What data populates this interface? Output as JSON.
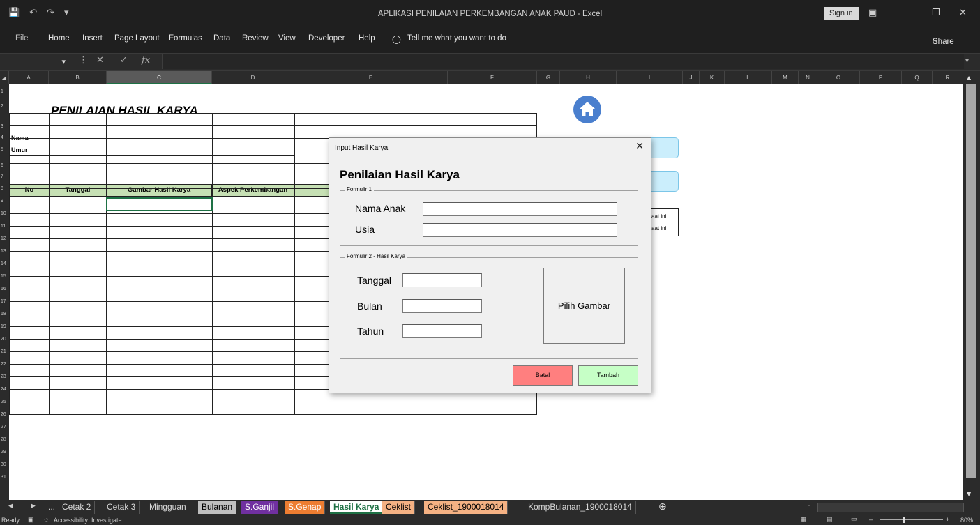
{
  "window": {
    "title": "APLIKASI PENILAIAN PERKEMBANGAN ANAK PAUD  -  Excel",
    "sign_in": "Sign in"
  },
  "ribbon": {
    "tabs": [
      "File",
      "Home",
      "Insert",
      "Page Layout",
      "Formulas",
      "Data",
      "Review",
      "View",
      "Developer",
      "Help"
    ],
    "tell_me": "Tell me what you want to do",
    "share": "Share"
  },
  "formula_bar": {
    "fx": "fx"
  },
  "columns": [
    "A",
    "B",
    "C",
    "D",
    "E",
    "F",
    "G",
    "H",
    "I",
    "J",
    "K",
    "L",
    "M",
    "N",
    "O",
    "P",
    "Q",
    "R"
  ],
  "sheet": {
    "title": "PENILAIAN HASIL KARYA",
    "nama_label": "Nama",
    "umur_label": "Umur",
    "headers": {
      "no": "No",
      "tanggal": "Tanggal",
      "gambar": "Gambar Hasil Karya",
      "aspek": "Aspek Perkembangan"
    },
    "note_line1": "aat ini",
    "note_line2": "aat ini"
  },
  "dialog": {
    "title": "Input Hasil Karya",
    "heading": "Penilaian Hasil Karya",
    "frame1_caption": "Formulir 1",
    "nama_anak_label": "Nama Anak",
    "usia_label": "Usia",
    "frame2_caption": "Formulir 2 - Hasil Karya",
    "tanggal_label": "Tanggal",
    "bulan_label": "Bulan",
    "tahun_label": "Tahun",
    "pilih_gambar": "Pilih Gambar",
    "batal": "Batal",
    "tambah": "Tambah"
  },
  "sheet_tabs": [
    {
      "label": "...",
      "color": "#2b2b2b",
      "text": "#d8d8d8"
    },
    {
      "label": "Cetak 2",
      "color": "#2b2b2b",
      "text": "#d8d8d8"
    },
    {
      "label": "Cetak 3",
      "color": "#2b2b2b",
      "text": "#d8d8d8"
    },
    {
      "label": "Mingguan",
      "color": "#2b2b2b",
      "text": "#d8d8d8"
    },
    {
      "label": "Bulanan",
      "color": "#bfbfbf",
      "text": "#000000"
    },
    {
      "label": "S.Ganjil",
      "color": "#7030a0",
      "text": "#ffffff"
    },
    {
      "label": "S.Genap",
      "color": "#ed7d31",
      "text": "#ffffff"
    },
    {
      "label": "Hasil Karya",
      "color": "#ffffff",
      "text": "#1e7145"
    },
    {
      "label": "Ceklist",
      "color": "#f4b183",
      "text": "#000000"
    },
    {
      "label": "Ceklist_1900018014",
      "color": "#f4b183",
      "text": "#000000"
    },
    {
      "label": "KompBulanan_1900018014",
      "color": "#2b2b2b",
      "text": "#d8d8d8"
    }
  ],
  "status": {
    "ready": "Ready",
    "accessibility": "Accessibility: Investigate",
    "zoom": "80%"
  },
  "colors": {
    "accent": "#1e7145",
    "batal": "#ff7f7f",
    "tambah": "#c6ffc6"
  }
}
